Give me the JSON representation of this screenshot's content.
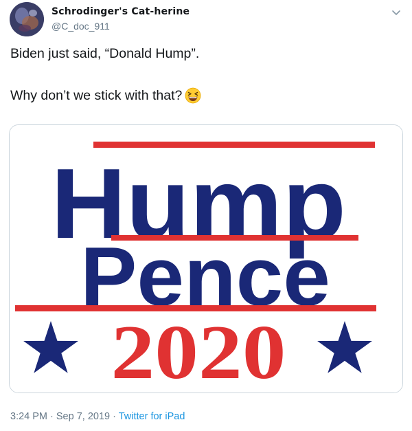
{
  "user": {
    "display_name": "Schrodinger's Cat-herine",
    "handle": "@C_doc_911"
  },
  "tweet": {
    "line1": "Biden just said, “Donald Hump”.",
    "line2": "Why don’t we stick with that?",
    "emoji": "grinning-squinting-face"
  },
  "media": {
    "line1": "Hump",
    "line2": "Pence",
    "line3": "2020",
    "colors": {
      "blue": "#1a2877",
      "red": "#e03232"
    }
  },
  "meta": {
    "time": "3:24 PM",
    "separator1": " · ",
    "date": "Sep 7, 2019",
    "separator2": " · ",
    "source": "Twitter for iPad"
  },
  "colors": {
    "text": "#14171a",
    "secondary": "#657786",
    "link": "#1b95e0",
    "border": "#ccd6dd"
  }
}
